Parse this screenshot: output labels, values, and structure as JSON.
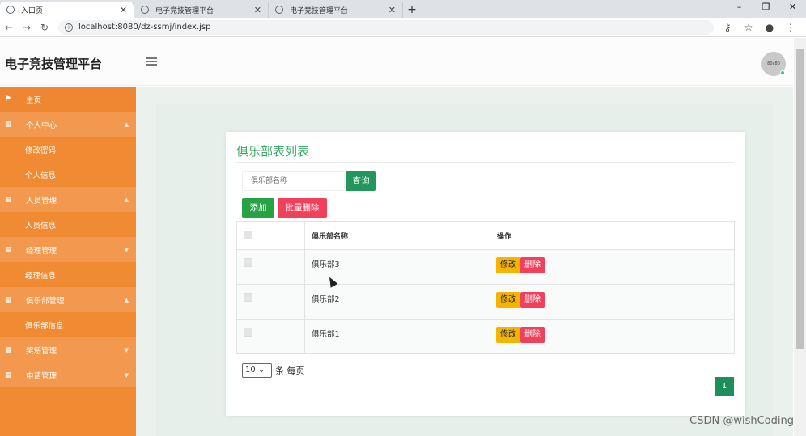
{
  "browser": {
    "tabs": [
      {
        "title": "入口页",
        "active": true
      },
      {
        "title": "电子竞技管理平台",
        "active": false
      },
      {
        "title": "电子竞技管理平台",
        "active": false
      }
    ],
    "new_tab": "+",
    "url": "localhost:8080/dz-ssmj/index.jsp",
    "win_min": "–",
    "win_max": "❐",
    "win_close": "✕"
  },
  "header": {
    "brand": "电子竞技管理平台",
    "avatar_text": "80x80"
  },
  "sidebar": {
    "items": [
      {
        "label": "主页",
        "kind": "top"
      },
      {
        "label": "个人中心",
        "kind": "group"
      },
      {
        "label": "修改密码",
        "kind": "sub"
      },
      {
        "label": "个人信息",
        "kind": "sub"
      },
      {
        "label": "人员管理",
        "kind": "group"
      },
      {
        "label": "人员信息",
        "kind": "sub"
      },
      {
        "label": "经理管理",
        "kind": "group"
      },
      {
        "label": "经理信息",
        "kind": "sub"
      },
      {
        "label": "俱乐部管理",
        "kind": "group"
      },
      {
        "label": "俱乐部信息",
        "kind": "sub"
      },
      {
        "label": "奖惩管理",
        "kind": "group"
      },
      {
        "label": "申请管理",
        "kind": "group"
      }
    ]
  },
  "main": {
    "title": "俱乐部表列表",
    "search_placeholder": "俱乐部名称",
    "query_button": "查询",
    "add_button": "添加",
    "batch_delete_button": "批量删除",
    "table": {
      "headers": [
        "",
        "俱乐部名称",
        "操作"
      ],
      "rows": [
        {
          "name": "俱乐部3"
        },
        {
          "name": "俱乐部2"
        },
        {
          "name": "俱乐部1"
        }
      ],
      "edit_label": "修改",
      "delete_label": "删除"
    },
    "page_size": "10",
    "page_size_suffix": "条 每页",
    "current_page": "1"
  },
  "watermark": "CSDN @wishCoding"
}
